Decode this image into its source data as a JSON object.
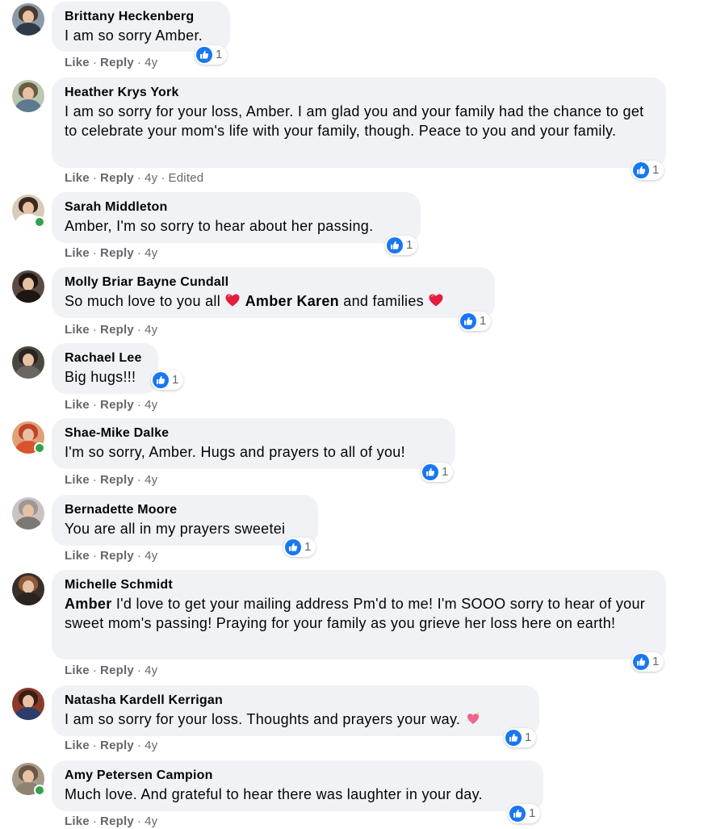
{
  "labels": {
    "like": "Like",
    "reply": "Reply",
    "dot": "·"
  },
  "colors": {
    "bubble": "#f0f2f5",
    "like_blue": "#1877f2",
    "meta_gray": "#65676b",
    "online": "#31a24c",
    "heart_red": "#e41e3f"
  },
  "comments": [
    {
      "author": "Brittany Heckenberg",
      "text": "I am so sorry Amber.",
      "time": "4y",
      "edited": "",
      "reactions": "1",
      "reaction_icon": "like-icon",
      "online": false
    },
    {
      "author": "Heather Krys York",
      "text": "I am so sorry for your loss, Amber. I am glad you and your family had the chance to get to celebrate your mom's life with your family, though. Peace to you and your family.",
      "time": "4y",
      "edited": "Edited",
      "reactions": "1",
      "reaction_icon": "like-icon",
      "online": false
    },
    {
      "author": "Sarah Middleton",
      "text": "Amber, I'm so sorry to hear about her passing.",
      "time": "4y",
      "edited": "",
      "reactions": "1",
      "reaction_icon": "like-icon",
      "online": true
    },
    {
      "author": "Molly Briar Bayne Cundall",
      "text_before": "So much love to you all",
      "mention": "Amber Karen",
      "text_after": "and families",
      "time": "4y",
      "edited": "",
      "reactions": "1",
      "reaction_icon": "like-icon",
      "online": false,
      "emoji": "red-heart-icon"
    },
    {
      "author": "Rachael Lee",
      "text": "Big hugs!!!",
      "time": "4y",
      "edited": "",
      "reactions": "1",
      "reaction_icon": "like-icon",
      "online": false
    },
    {
      "author": "Shae-Mike Dalke",
      "text": "I'm so sorry, Amber. Hugs and prayers to all of you!",
      "time": "4y",
      "edited": "",
      "reactions": "1",
      "reaction_icon": "like-icon",
      "online": true
    },
    {
      "author": "Bernadette Moore",
      "text": "You are all in my prayers sweetei",
      "time": "4y",
      "edited": "",
      "reactions": "1",
      "reaction_icon": "like-icon",
      "online": false
    },
    {
      "author": "Michelle Schmidt",
      "mention": "Amber",
      "text": "I'd love to get your mailing address Pm'd to me! I'm SOOO sorry to hear of your sweet mom's passing! Praying for your family as you grieve her loss here on earth!",
      "time": "4y",
      "edited": "",
      "reactions": "1",
      "reaction_icon": "like-icon",
      "online": false
    },
    {
      "author": "Natasha Kardell Kerrigan",
      "text": "I am so sorry for your loss. Thoughts and prayers your way.",
      "time": "4y",
      "edited": "",
      "reactions": "1",
      "reaction_icon": "like-icon",
      "online": false,
      "emoji": "sparkling-heart-icon"
    },
    {
      "author": "Amy Petersen Campion",
      "text": "Much love. And grateful to hear there was laughter in your day.",
      "time": "4y",
      "edited": "",
      "reactions": "1",
      "reaction_icon": "like-icon",
      "online": true
    }
  ]
}
